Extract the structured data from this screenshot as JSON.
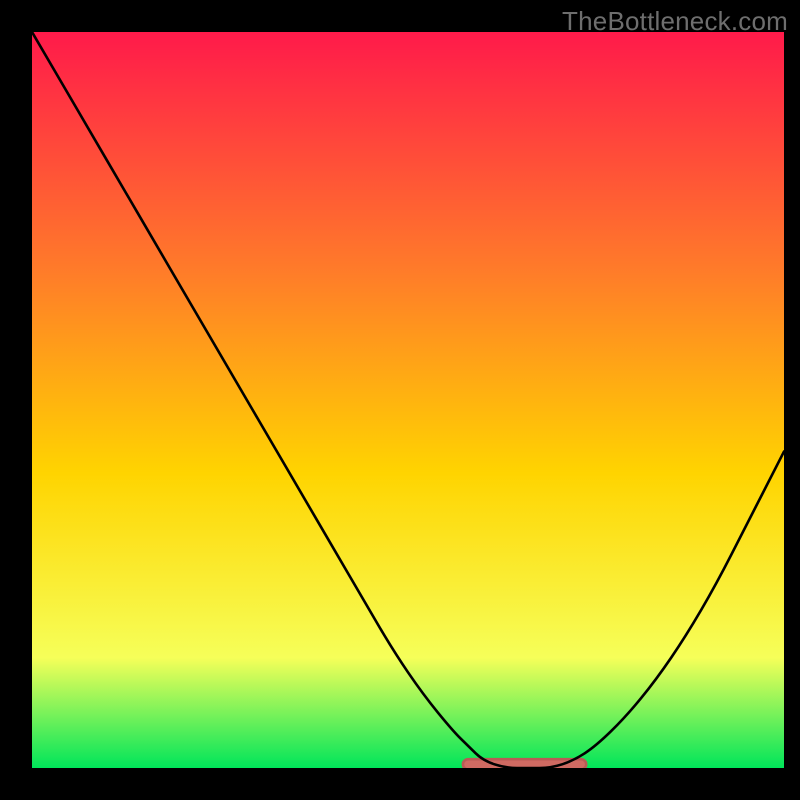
{
  "watermark": "TheBottleneck.com",
  "colors": {
    "top": "#ff1a4a",
    "mid1": "#ff7a2a",
    "mid2": "#ffd400",
    "mid3": "#f6ff59",
    "bottom": "#00e55a",
    "curve": "#000000",
    "band": "#cf6a62",
    "bandOutline": "#b95a55",
    "border": "#000000"
  },
  "chart_data": {
    "type": "line",
    "title": "",
    "xlabel": "",
    "ylabel": "",
    "xlim": [
      0,
      100
    ],
    "ylim": [
      0,
      100
    ],
    "x": [
      0,
      4,
      8,
      12,
      16,
      20,
      24,
      28,
      32,
      36,
      40,
      44,
      48,
      52,
      56,
      58,
      60,
      63,
      66,
      69,
      72,
      75,
      79,
      83,
      87,
      91,
      95,
      100
    ],
    "values": [
      100,
      93,
      86,
      79,
      72,
      65,
      58,
      51,
      44,
      37,
      30,
      23,
      16,
      10,
      5,
      3,
      1,
      0,
      0,
      0,
      1,
      3,
      7,
      12,
      18,
      25,
      33,
      43
    ],
    "optimum_band": {
      "x_start": 58,
      "x_end": 73,
      "y": 0.5,
      "thickness": 1.4
    }
  }
}
